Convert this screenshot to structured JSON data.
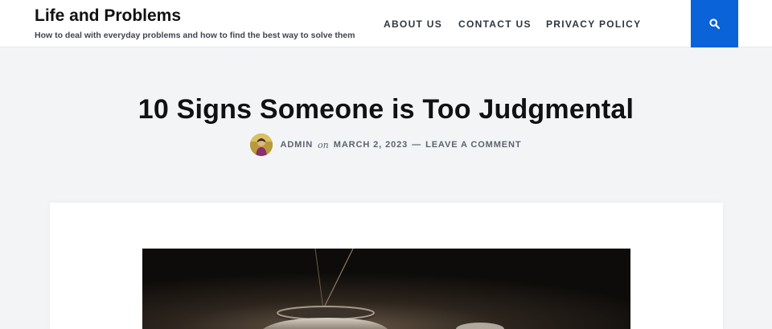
{
  "site": {
    "title": "Life and Problems",
    "tagline": "How to deal with everyday problems and how to find the best way to solve them"
  },
  "nav": {
    "items": [
      {
        "label": "ABOUT US"
      },
      {
        "label": "CONTACT US"
      },
      {
        "label": "PRIVACY POLICY"
      }
    ],
    "search_icon": "search-icon",
    "accent_color": "#0a63d8"
  },
  "post": {
    "title": "10 Signs Someone is Too Judgmental",
    "author": "ADMIN",
    "on_word": "on",
    "date": "MARCH 2, 2023",
    "separator": "—",
    "comment_link": "LEAVE A COMMENT"
  },
  "colors": {
    "page_background": "#f3f4f6",
    "header_background": "#ffffff",
    "card_background": "#ffffff"
  }
}
